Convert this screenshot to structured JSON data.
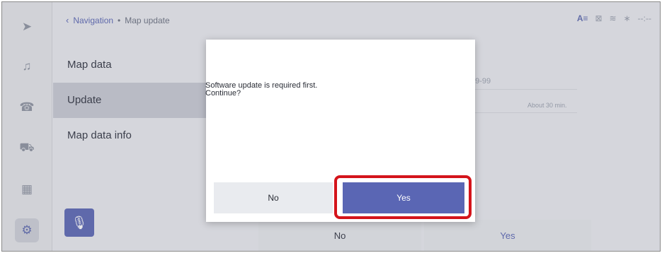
{
  "breadcrumb": {
    "back_icon": "‹",
    "parent": "Navigation",
    "separator": "•",
    "current": "Map update"
  },
  "status": {
    "accent": "A≡",
    "icons": [
      "no-map-icon",
      "wifi-icon",
      "bluetooth-icon"
    ],
    "time": "--:--"
  },
  "rail": {
    "icons": [
      "navigation-icon",
      "music-icon",
      "phone-icon",
      "car-icon",
      "apps-icon",
      "settings-icon"
    ],
    "active": "settings-icon"
  },
  "menu": {
    "items": [
      "Map data",
      "Update",
      "Map data info"
    ],
    "selected": "Update"
  },
  "info": {
    "date": "99-99",
    "duration": "About 30 min."
  },
  "bottom_bar": {
    "no": "No",
    "yes": "Yes"
  },
  "dialog": {
    "line1": "Software update is required first.",
    "line2": "Continue?",
    "no": "No",
    "yes": "Yes"
  },
  "colors": {
    "accent": "#5a66b4",
    "highlight": "#d4141b"
  }
}
